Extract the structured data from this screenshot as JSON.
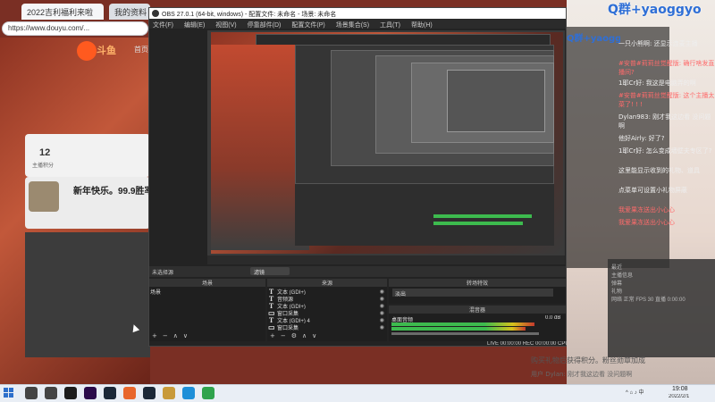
{
  "browser": {
    "tab1": "2022吉利福利来啦",
    "tab2": "我的资料",
    "address": "https://www.douyu.com/...",
    "logo_text": "斗鱼",
    "home": "首页",
    "stat_num": "12",
    "stat_label": "主播积分",
    "card_title": "新年快乐。99.9胜率"
  },
  "obs": {
    "title": "OBS 27.0.1 (64-bit, windows) - 配置文件: 未命名 - 场景: 未命名",
    "menu": [
      "文件(F)",
      "编辑(E)",
      "视图(V)",
      "停靠部件(D)",
      "配置文件(P)",
      "场景集合(S)",
      "工具(T)",
      "帮助(H)"
    ],
    "scene_filter_label": "未选择源",
    "filter_btn": "滤镜",
    "docks": {
      "scenes": "场景",
      "sources": "来源",
      "transitions": "转场特效",
      "mixer": "混音器"
    },
    "scene_item": "场景",
    "sources": [
      {
        "icon": "T",
        "name": "文本 (GDI+)"
      },
      {
        "icon": "T",
        "name": "音频源"
      },
      {
        "icon": "T",
        "name": "文本 (GDI+)"
      },
      {
        "icon": "▭",
        "name": "窗口采集"
      },
      {
        "icon": "T",
        "name": "文本 (GDI+) 4"
      },
      {
        "icon": "▭",
        "name": "窗口采集"
      }
    ],
    "transition_value": "淡出",
    "mixer_label": "桌面音频",
    "mixer_db": "0.0 dB",
    "status": "LIVE 00:00:00  REC 00:00:00  CPU: 0.4%, 60.00 fps"
  },
  "chat": {
    "group_title": "Q群+yaoggyo",
    "header": "Q群+yaoggyo",
    "messages": [
      {
        "text": "一只小熊啊: 还显示连麦主播",
        "style": "dark"
      },
      {
        "text": "#安普#莉莉丝觉醒版: 确行啥发直播间?",
        "style": "red"
      },
      {
        "text": "1耶Cr好: 我这是电脑弄的啊",
        "style": "dark"
      },
      {
        "text": "#安普#莉莉丝觉醒版: 这个主播太菜了! ! !",
        "style": "red"
      },
      {
        "text": "Dylan983: 刚才我这边看 没问题啊",
        "style": "dark"
      },
      {
        "text": "他好Airly: 好了?",
        "style": "dark"
      },
      {
        "text": "1耶Cr好: 怎么变成墙壁夫专区了?",
        "style": "dark"
      },
      {
        "text": "这里能显示收到的礼物、道具",
        "style": "dark"
      },
      {
        "text": "点菜单可设置小礼物屏蔽",
        "style": "dark"
      },
      {
        "text": "我爱果冻送出小心心",
        "style": "red"
      },
      {
        "text": "我爱果冻送出小心心",
        "style": "red"
      }
    ],
    "side_lines": [
      "最近",
      "主播信息",
      "弹幕",
      "礼物",
      "网络 正常 FPS 30 直播 0:00:00"
    ],
    "bottom_note": "购买礼物后获得积分。粉丝勋章加成",
    "bottom_note2": "用户 Dylan: 刚才我这边看 没问题啊"
  },
  "taskbar": {
    "time": "19:08",
    "date": "2022/2/1",
    "icons": [
      "search-icon",
      "taskview-icon",
      "obs-icon",
      "premiere-icon",
      "steam-icon",
      "browser-icon",
      "steam2-icon",
      "game-icon",
      "edge-icon",
      "chat-icon"
    ],
    "icon_colors": [
      "#444444",
      "#444444",
      "#1c1c1c",
      "#2a0a4a",
      "#1b2838",
      "#e8662c",
      "#1b2838",
      "#c89a3a",
      "#1e8fd8",
      "#2fa34c"
    ]
  }
}
